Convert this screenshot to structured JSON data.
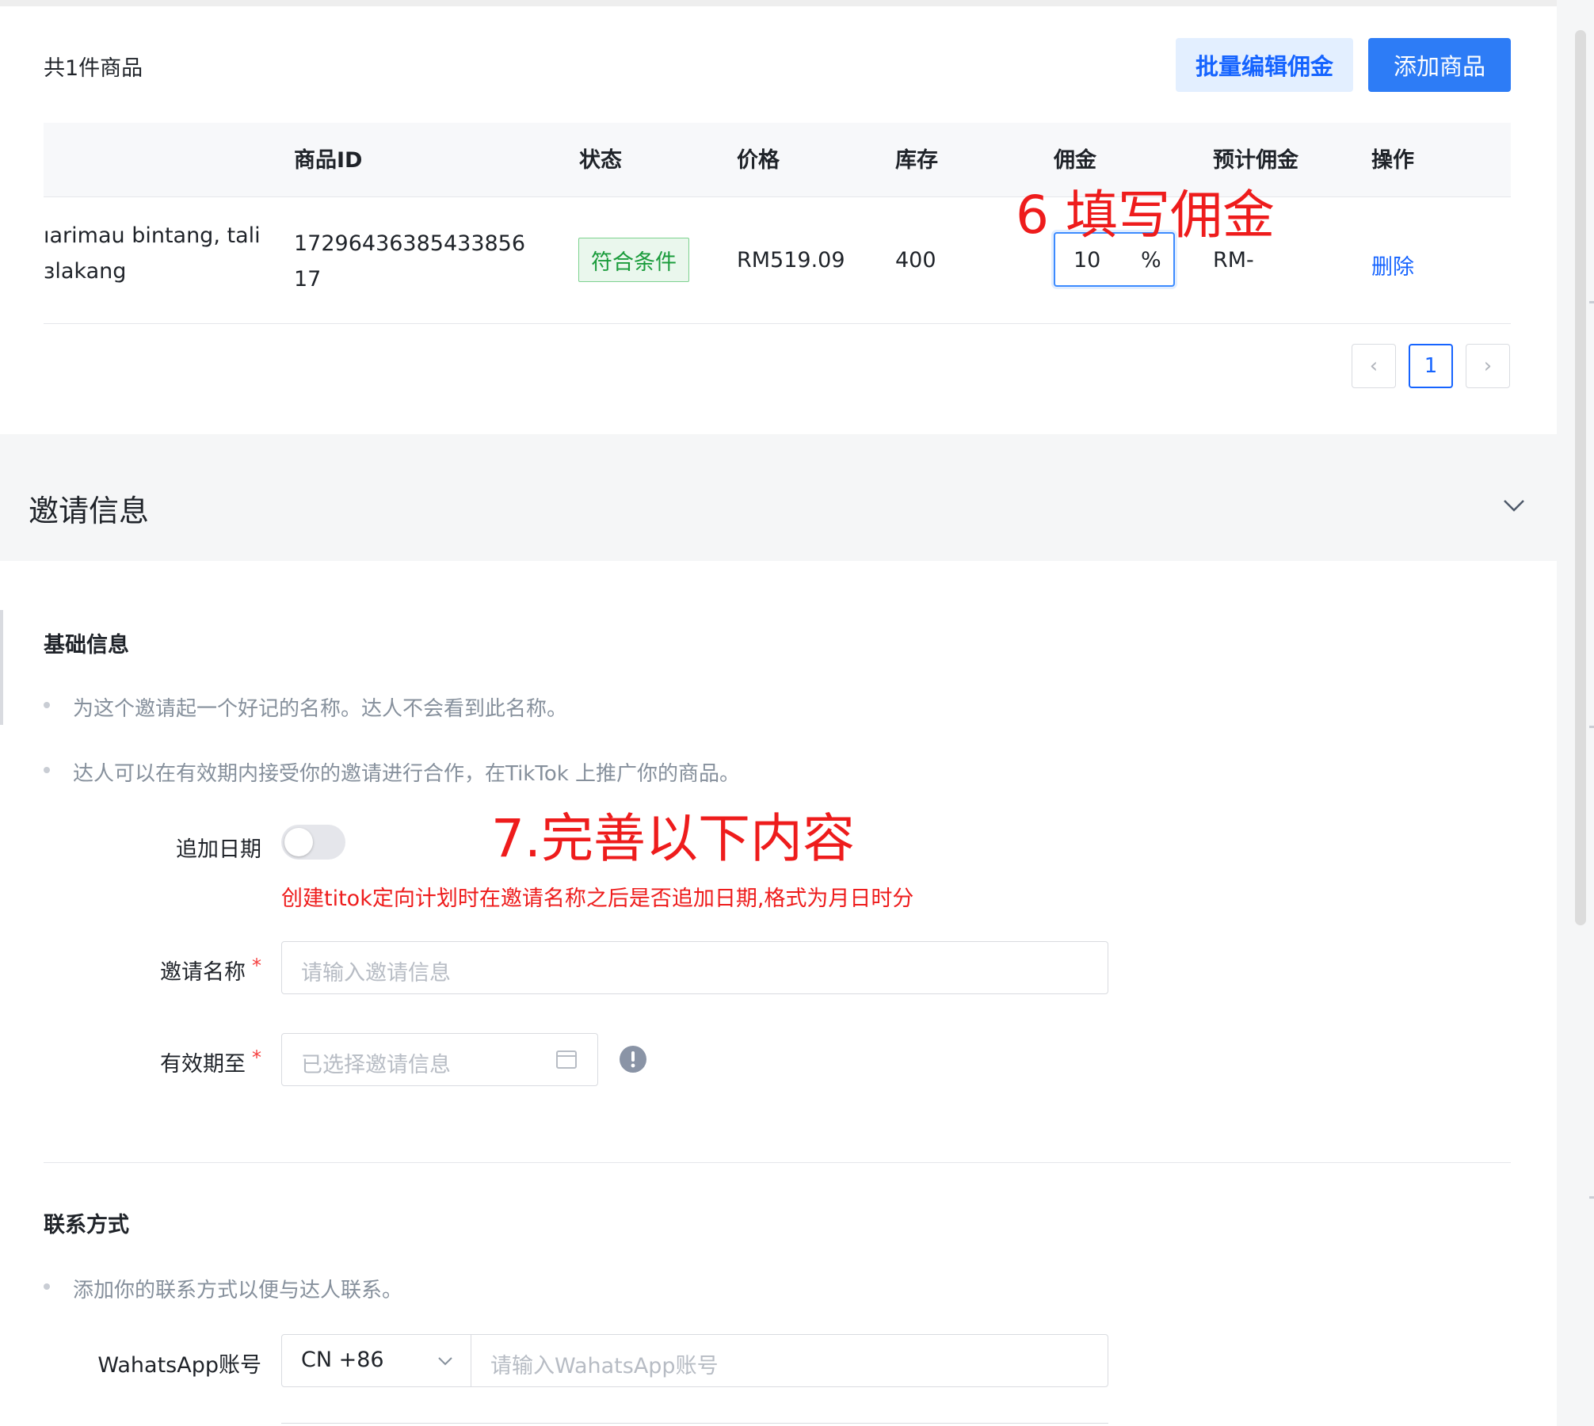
{
  "products": {
    "count_label": "共1件商品",
    "batch_edit_label": "批量编辑佣金",
    "add_product_label": "添加商品",
    "columns": {
      "id": "商品ID",
      "status": "状态",
      "price": "价格",
      "stock": "库存",
      "commission": "佣金",
      "est_commission": "预计佣金",
      "action": "操作"
    },
    "row": {
      "name_line1": "ıarimau bintang, tali",
      "name_line2": "ɜlakang",
      "id_line1": "17296436385433856",
      "id_line2": "17",
      "status": "符合条件",
      "price": "RM519.09",
      "stock": "400",
      "commission_value": "10",
      "commission_unit": "%",
      "est_commission": "RM-",
      "delete_label": "删除"
    },
    "pagination": {
      "prev": "‹",
      "current": "1",
      "next": "›"
    }
  },
  "annotations": {
    "step6": "6 填写佣金",
    "step7": "7.完善以下内容"
  },
  "invite": {
    "section_title": "邀请信息",
    "basic": {
      "title": "基础信息",
      "bullet1": "为这个邀请起一个好记的名称。达人不会看到此名称。",
      "bullet2": "达人可以在有效期内接受你的邀请进行合作，在TikTok 上推广你的商品。",
      "append_date_label": "追加日期",
      "append_date_hint": "创建titok定向计划时在邀请名称之后是否追加日期,格式为月日时分",
      "name_label": "邀请名称",
      "name_placeholder": "请输入邀请信息",
      "valid_label": "有效期至",
      "valid_placeholder": "已选择邀请信息",
      "required_mark": "*"
    },
    "contact": {
      "title": "联系方式",
      "bullet1": "添加你的联系方式以便与达人联系。",
      "whatsapp_label": "WahatsApp账号",
      "country_code": "CN +86",
      "whatsapp_placeholder": "请输入WahatsApp账号"
    }
  },
  "colors": {
    "primary": "#2d7cf6",
    "annotation": "#ee1c1c",
    "success": "#1b9c3c"
  }
}
